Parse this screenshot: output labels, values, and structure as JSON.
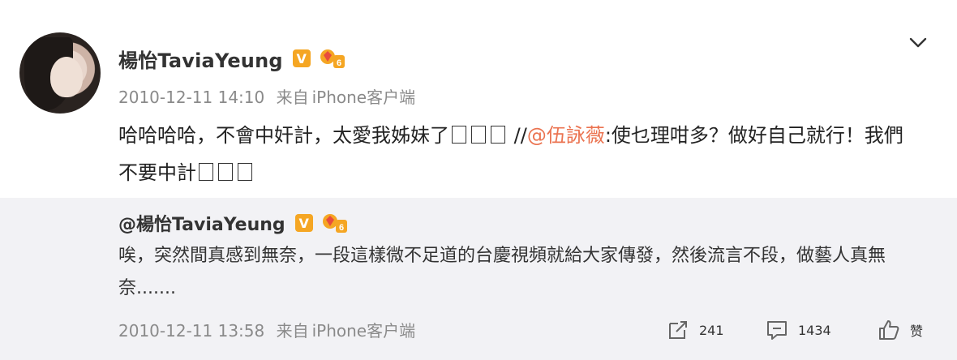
{
  "post": {
    "author": "楊怡TaviaYeung",
    "vip_badge": "V",
    "timestamp": "2010-12-11 14:10",
    "source_prefix": "来自",
    "source": "iPhone客户端",
    "text_before": "哈哈哈哈，不會中奸計，太愛我姊妹了",
    "text_repost_sep": " //",
    "mention": "@伍詠薇",
    "text_after": ":使乜理咁多？做好自己就行！我們不要中計"
  },
  "repost": {
    "author": "@楊怡TaviaYeung",
    "vip_badge": "V",
    "text": "唉，突然間真感到無奈，一段這樣微不足道的台慶視頻就給大家傳發，然後流言不段，做藝人真無奈.......",
    "timestamp": "2010-12-11 13:58",
    "source_prefix": "来自",
    "source": "iPhone客户端",
    "actions": {
      "forward_count": "241",
      "comment_count": "1434",
      "like_label": "赞"
    }
  },
  "icons": {
    "menu": "chevron-down-icon",
    "forward": "share-icon",
    "comment": "comment-icon",
    "like": "thumbs-up-icon"
  },
  "colors": {
    "mention": "#eb7350",
    "vip": "#f5a623",
    "repost_bg": "#f2f2f5"
  }
}
